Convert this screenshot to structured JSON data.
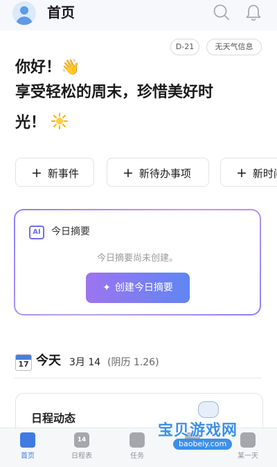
{
  "header": {
    "title": "首页"
  },
  "chips": {
    "days": "D-21",
    "weather": "无天气信息"
  },
  "greeting": {
    "line1": "你好！",
    "line2": "享受轻松的周末，珍惜美好时",
    "line3": "光！"
  },
  "quick_actions": [
    {
      "label": "新事件"
    },
    {
      "label": "新待办事项"
    },
    {
      "label": "新时间"
    }
  ],
  "summary": {
    "badge": "AI",
    "title": "今日摘要",
    "empty_text": "今日摘要尚未创建。",
    "button_label": "创建今日摘要"
  },
  "today": {
    "icon_month": "July",
    "icon_day": "17",
    "label": "今天",
    "date": "3月 14",
    "lunar": "(阴历 1.26)"
  },
  "schedule": {
    "title": "日程动态"
  },
  "nav": {
    "items": [
      {
        "label": "首页",
        "active": true
      },
      {
        "label": "日程表",
        "icon_num": "14"
      },
      {
        "label": "任务"
      },
      {
        "label": ""
      },
      {
        "label": "某一天"
      }
    ]
  },
  "watermark": {
    "text": "宝贝游戏网",
    "url": "baobeiy.com"
  },
  "colors": {
    "accent": "#3f7be0",
    "ai_gradient_start": "#9d74f0",
    "ai_gradient_end": "#5f86f2"
  }
}
